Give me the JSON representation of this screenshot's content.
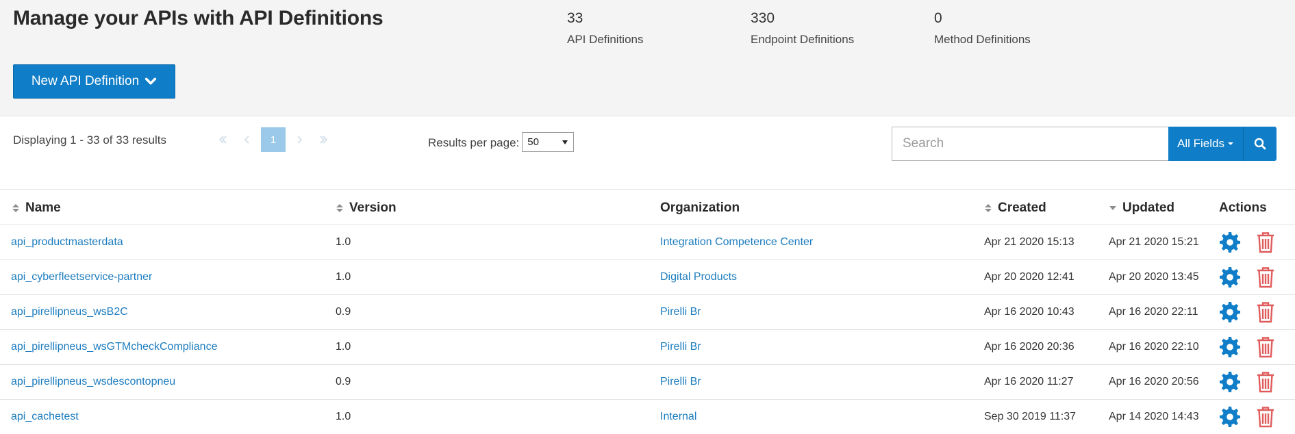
{
  "header": {
    "title": "Manage your APIs with API Definitions",
    "stats": [
      {
        "value": "33",
        "label": "API Definitions"
      },
      {
        "value": "330",
        "label": "Endpoint Definitions"
      },
      {
        "value": "0",
        "label": "Method Definitions"
      }
    ],
    "new_button_label": "New API Definition",
    "accent_color": "#0f7dc7"
  },
  "toolbar": {
    "displaying": "Displaying 1 - 33 of 33 results",
    "pager": {
      "current_page": "1"
    },
    "results_per_page_label": "Results per page:",
    "results_per_page_value": "50",
    "search_placeholder": "Search",
    "fields_label": "All Fields"
  },
  "table": {
    "columns": [
      "Name",
      "Version",
      "Organization",
      "Created",
      "Updated",
      "Actions"
    ],
    "rows": [
      {
        "name": "api_productmasterdata",
        "version": "1.0",
        "organization": "Integration Competence Center",
        "created": "Apr 21 2020 15:13",
        "updated": "Apr 21 2020 15:21"
      },
      {
        "name": "api_cyberfleetservice-partner",
        "version": "1.0",
        "organization": "Digital Products",
        "created": "Apr 20 2020 12:41",
        "updated": "Apr 20 2020 13:45"
      },
      {
        "name": "api_pirellipneus_wsB2C",
        "version": "0.9",
        "organization": "Pirelli Br",
        "created": "Apr 16 2020 10:43",
        "updated": "Apr 16 2020 22:11"
      },
      {
        "name": "api_pirellipneus_wsGTMcheckCompliance",
        "version": "1.0",
        "organization": "Pirelli Br",
        "created": "Apr 16 2020 20:36",
        "updated": "Apr 16 2020 22:10"
      },
      {
        "name": "api_pirellipneus_wsdescontopneu",
        "version": "0.9",
        "organization": "Pirelli Br",
        "created": "Apr 16 2020 11:27",
        "updated": "Apr 16 2020 20:56"
      },
      {
        "name": "api_cachetest",
        "version": "1.0",
        "organization": "Internal",
        "created": "Sep 30 2019 11:37",
        "updated": "Apr 14 2020 14:43"
      }
    ]
  }
}
